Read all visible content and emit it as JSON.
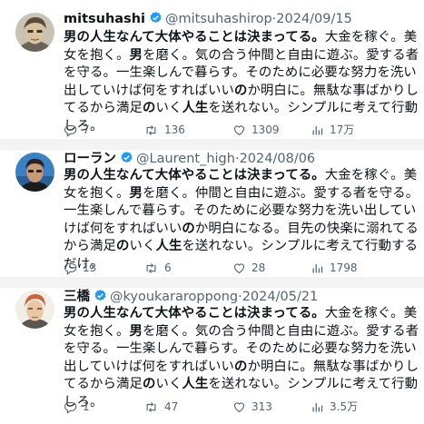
{
  "tweets": [
    {
      "display_name": "mitsuhashi",
      "handle": "@mitsuhashirop",
      "dot": "·",
      "date": "2024/09/15",
      "text_html": "<b>男の人生なんて大体やることは決まってる。</b>大金を稼ぐ。美女を抱く。<b>男</b>を磨く。気の合う仲間と自由に遊ぶ。愛する者を守る。一生楽しんで暮らす。そのために必要な努力を洗い出していけば何をすればいい<b>の</b>か明白に。無駄な事ばかりしてるから満足<b>の</b>いく<b>人生</b>を送れない。シンプルに考えて行動しろ。",
      "replies": "7",
      "retweets": "136",
      "likes": "1309",
      "views": "17万",
      "avatar_colors": {
        "bg": "#c9c3b4",
        "skin": "#d9c2a0",
        "hair": "#5a4a3a"
      }
    },
    {
      "display_name": "ローラン",
      "handle": "@Laurent_high",
      "dot": "·",
      "date": "2024/08/06",
      "text_html": "<b>男の人生なんて大体やることは決まってる。</b>大金を稼ぐ。美女を抱く。<b>男</b>を磨く。仲間と自由に遊ぶ。愛する者を守る。一生楽しんで暮らす。そのために必要な努力を洗い出していけば何をすればいい<b>の</b>か明白になる。目先の快楽に溺れてるから満足<b>の</b>いく<b>人生</b>を送れない。シンプルに考えて行動するだけ。",
      "replies": "13",
      "retweets": "6",
      "likes": "28",
      "views": "1798",
      "avatar_colors": {
        "bg": "#3b7fc4",
        "skin": "#c89a78",
        "hair": "#2a2220"
      }
    },
    {
      "display_name": "三橋",
      "handle": "@kyoukararoppong",
      "dot": "·",
      "date": "2024/05/21",
      "text_html": "<b>男の人生なんて大体やることは決まってる。</b>大金を稼ぐ。美女を抱く。<b>男</b>を磨く。気の合う仲間と自由に遊ぶ。愛する者を守る。一生楽しんで暮らす。そのために必要な努力を洗い出していけば何をすればいい<b>の</b>か明白に。無駄な事ばかりしてるから満足<b>の</b>いく<b>人生</b>を送れない。シンプルに考えて行動しろ。",
      "replies": "1",
      "retweets": "47",
      "likes": "313",
      "views": "3.5万",
      "avatar_colors": {
        "bg": "#f2eee8",
        "skin": "#e8c6a6",
        "hair": "#c8643a"
      }
    }
  ],
  "icons": {
    "reply": "reply-icon",
    "retweet": "retweet-icon",
    "like": "heart-icon",
    "views": "views-icon",
    "verified": "verified-badge-icon"
  },
  "colors": {
    "verified": "#1d9bf0",
    "meta": "#536471",
    "separator": "#f3f3f3"
  }
}
